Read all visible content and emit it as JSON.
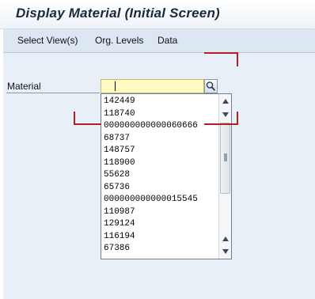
{
  "window": {
    "title": "Display Material (Initial Screen)"
  },
  "menu": {
    "items": [
      "Select View(s)",
      "Org. Levels",
      "Data"
    ]
  },
  "form": {
    "material_label": "Material",
    "material_value": ""
  },
  "dropdown": {
    "items": [
      "142449",
      "118740",
      "000000000000060666",
      "68737",
      "148757",
      "118900",
      "55628",
      "65736",
      "000000000000015545",
      "110987",
      "129124",
      "116194",
      "67386"
    ]
  },
  "colors": {
    "annotation": "#b0201c",
    "input_background": "#fff9c4",
    "menubar": "#dde7f1"
  }
}
